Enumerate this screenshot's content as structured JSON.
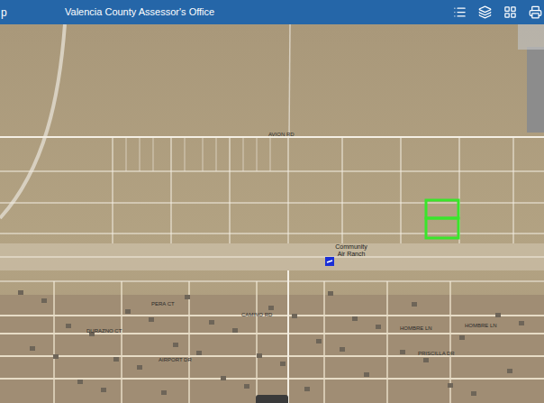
{
  "header": {
    "app_title_fragment": "p",
    "title": "Valencia County Assessor's Office",
    "tools": [
      {
        "name": "list"
      },
      {
        "name": "layers"
      },
      {
        "name": "basemaps"
      },
      {
        "name": "print"
      }
    ]
  },
  "map": {
    "labels": [
      {
        "text": "AVION RD",
        "kind": "road"
      },
      {
        "text": "Community Air Ranch",
        "kind": "place"
      },
      {
        "text": "PERA CT",
        "kind": "road"
      },
      {
        "text": "CAMINO RD",
        "kind": "road"
      },
      {
        "text": "DURAZNO CT",
        "kind": "road"
      },
      {
        "text": "HOMBRE LN",
        "kind": "road"
      },
      {
        "text": "HOMBRE LN",
        "kind": "road"
      },
      {
        "text": "AIRPORT DR",
        "kind": "road"
      },
      {
        "text": "PRISCILLA DR",
        "kind": "road"
      }
    ],
    "parcels": [
      {
        "selected": true
      },
      {
        "selected": true
      }
    ]
  }
}
